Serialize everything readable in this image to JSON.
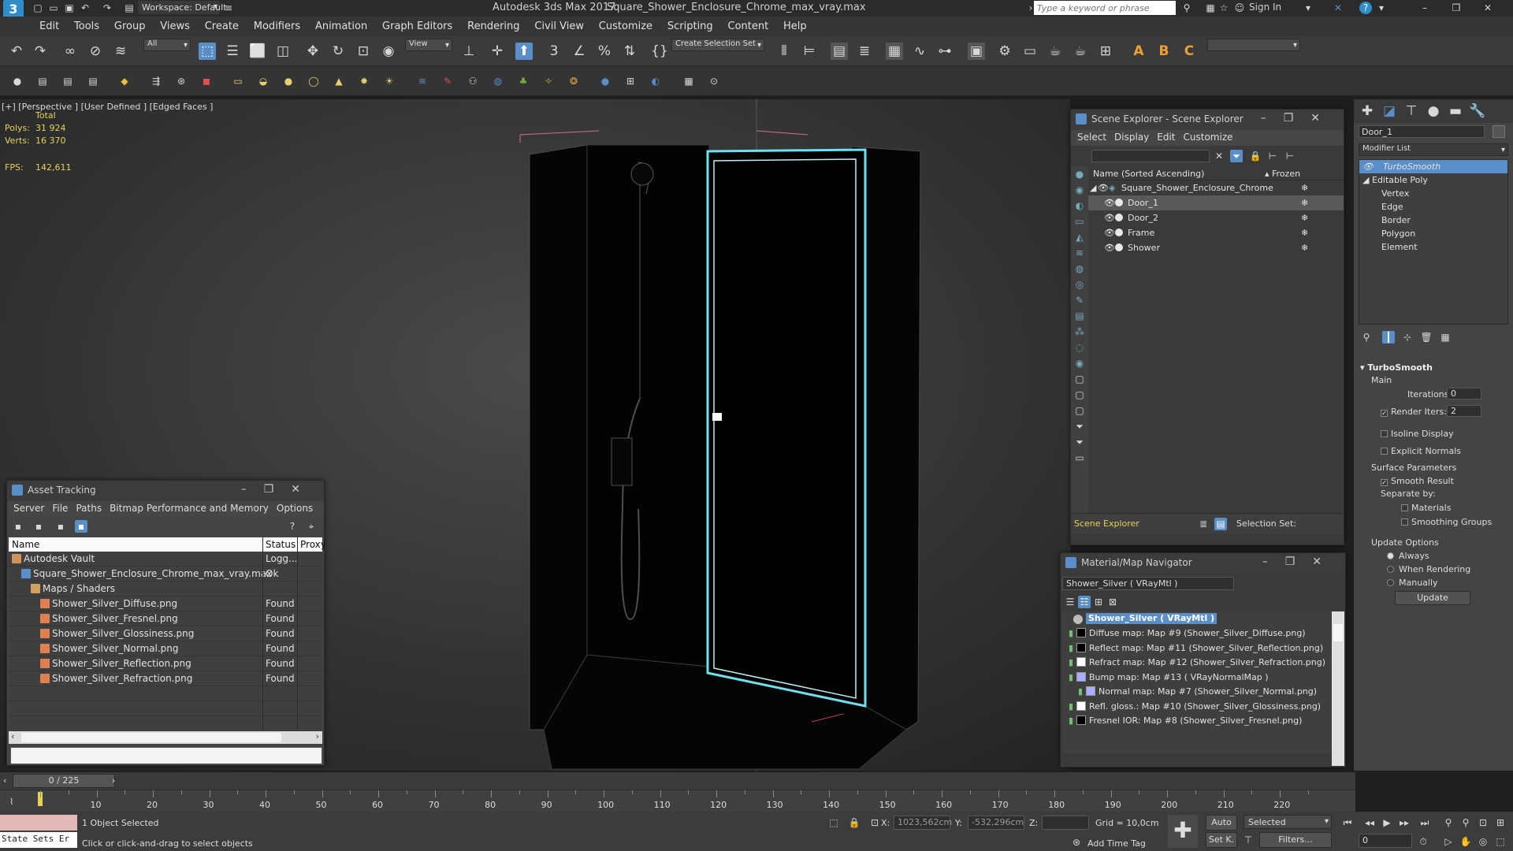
{
  "titlebar": {
    "app_title": "Autodesk 3ds Max 2017",
    "file_title": "Square_Shower_Enclosure_Chrome_max_vray.max",
    "workspace_label": "Workspace: Default",
    "search_placeholder": "Type a keyword or phrase",
    "sign_in": "Sign In"
  },
  "menubar": {
    "items": [
      "Edit",
      "Tools",
      "Group",
      "Views",
      "Create",
      "Modifiers",
      "Animation",
      "Graph Editors",
      "Rendering",
      "Civil View",
      "Customize",
      "Scripting",
      "Content",
      "Help"
    ]
  },
  "toolbar": {
    "selection_filter": "All",
    "ref_coord": "View",
    "create_selection_set": "Create Selection Set"
  },
  "viewport": {
    "label": "[+] [Perspective ]  [User Defined ]  [Edged Faces ]",
    "stats_total": "Total",
    "polys_label": "Polys:",
    "polys_value": "31 924",
    "verts_label": "Verts:",
    "verts_value": "16 370",
    "fps_label": "FPS:",
    "fps_value": "142,611"
  },
  "asset_tracking": {
    "title": "Asset Tracking",
    "menu": [
      "Server",
      "File",
      "Paths",
      "Bitmap Performance and Memory",
      "Options"
    ],
    "columns": [
      "Name",
      "Status",
      "Proxy"
    ],
    "rows": [
      {
        "name": "Autodesk Vault",
        "status": "Logg...",
        "indent": 0,
        "kind": "vault"
      },
      {
        "name": "Square_Shower_Enclosure_Chrome_max_vray.max",
        "status": "Ok",
        "indent": 1,
        "kind": "max"
      },
      {
        "name": "Maps / Shaders",
        "status": "",
        "indent": 2,
        "kind": "folder"
      },
      {
        "name": "Shower_Silver_Diffuse.png",
        "status": "Found",
        "indent": 3,
        "kind": "png"
      },
      {
        "name": "Shower_Silver_Fresnel.png",
        "status": "Found",
        "indent": 3,
        "kind": "png"
      },
      {
        "name": "Shower_Silver_Glossiness.png",
        "status": "Found",
        "indent": 3,
        "kind": "png"
      },
      {
        "name": "Shower_Silver_Normal.png",
        "status": "Found",
        "indent": 3,
        "kind": "png"
      },
      {
        "name": "Shower_Silver_Reflection.png",
        "status": "Found",
        "indent": 3,
        "kind": "png"
      },
      {
        "name": "Shower_Silver_Refraction.png",
        "status": "Found",
        "indent": 3,
        "kind": "png"
      }
    ]
  },
  "scene_explorer": {
    "title": "Scene Explorer - Scene Explorer",
    "menu": [
      "Select",
      "Display",
      "Edit",
      "Customize"
    ],
    "col_name": "Name (Sorted Ascending)",
    "col_frozen": "▴ Frozen",
    "root": "Square_Shower_Enclosure_Chrome",
    "children": [
      "Door_1",
      "Door_2",
      "Frame",
      "Shower"
    ],
    "footer_label": "Scene Explorer",
    "selection_set_label": "Selection Set:"
  },
  "material_navigator": {
    "title": "Material/Map Navigator",
    "current": "Shower_Silver  ( VRayMtl )",
    "root": "Shower_Silver  ( VRayMtl )",
    "maps": [
      "Diffuse map: Map #9 (Shower_Silver_Diffuse.png)",
      "Reflect map: Map #11 (Shower_Silver_Reflection.png)",
      "Refract map: Map #12 (Shower_Silver_Refraction.png)",
      "Bump map: Map #13  ( VRayNormalMap )",
      "Normal map: Map #7 (Shower_Silver_Normal.png)",
      "Refl. gloss.: Map #10 (Shower_Silver_Glossiness.png)",
      "Fresnel IOR: Map #8 (Shower_Silver_Fresnel.png)"
    ]
  },
  "command_panel": {
    "object_name": "Door_1",
    "modifier_list": "Modifier List",
    "stack": [
      "TurboSmooth",
      "Editable Poly",
      "Vertex",
      "Edge",
      "Border",
      "Polygon",
      "Element"
    ],
    "rollout_title": "TurboSmooth",
    "main_label": "Main",
    "iterations_label": "Iterations:",
    "iterations_value": "0",
    "render_iters_label": "Render Iters:",
    "render_iters_value": "2",
    "isoline_display": "Isoline Display",
    "explicit_normals": "Explicit Normals",
    "surface_params": "Surface Parameters",
    "smooth_result": "Smooth Result",
    "separate_by": "Separate by:",
    "materials": "Materials",
    "smoothing_groups": "Smoothing Groups",
    "update_options": "Update Options",
    "always": "Always",
    "when_rendering": "When Rendering",
    "manually": "Manually",
    "update_button": "Update"
  },
  "timeline": {
    "frame_counter": "0 / 225",
    "ticks": [
      "10",
      "20",
      "30",
      "40",
      "50",
      "60",
      "70",
      "80",
      "90",
      "100",
      "110",
      "120",
      "130",
      "140",
      "150",
      "160",
      "170",
      "180",
      "190",
      "200",
      "210",
      "220"
    ]
  },
  "statusbar": {
    "state_sets": "State Sets Er",
    "selected_count": "1 Object Selected",
    "prompt": "Click or click-and-drag to select objects",
    "x_label": "X:",
    "x_value": "1023,562cm",
    "y_label": "Y:",
    "y_value": "-532,296cm",
    "z_label": "Z:",
    "grid": "Grid = 10,0cm",
    "add_time_tag": "Add Time Tag",
    "auto": "Auto",
    "set_key": "Set K.",
    "selected_dropdown": "Selected",
    "filters": "Filters...",
    "frame_field": "0"
  },
  "colors": {
    "accent": "#5a8ec9",
    "selection_cyan": "#6fe0f0",
    "stats_yellow": "#e6d25a"
  }
}
